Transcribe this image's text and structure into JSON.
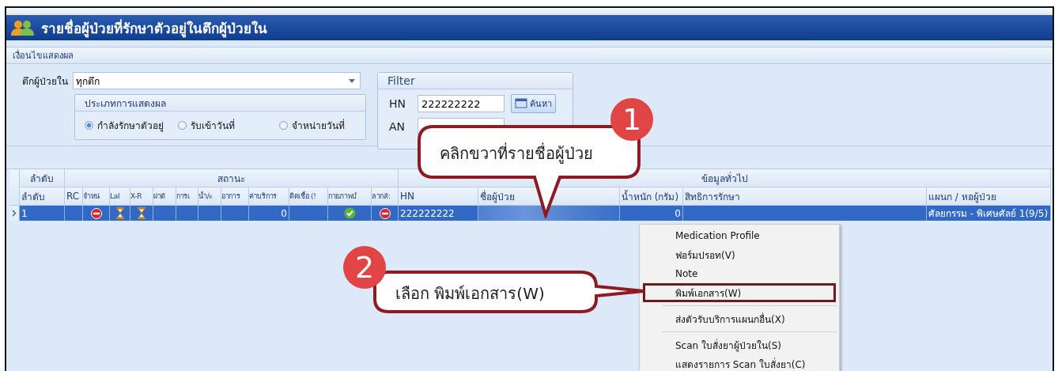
{
  "window": {
    "title": "รายชื่อผู้ป่วยที่รักษาตัวอยู่ในตึกผู้ป่วยใน"
  },
  "conditions_header": "เงื่อนไขแสดงผล",
  "ward": {
    "label": "ตึกผู้ป่วยใน",
    "value": "ทุกตึก"
  },
  "display_type": {
    "title": "ประเภทการแสดงผล",
    "options": [
      {
        "label": "กำลังรักษาตัวอยู่",
        "selected": true
      },
      {
        "label": "รับเข้าวันที่",
        "selected": false
      },
      {
        "label": "จำหน่ายวันที่",
        "selected": false
      }
    ]
  },
  "filter": {
    "title": "Filter",
    "hn_label": "HN",
    "hn_value": "222222222",
    "search_button": "ค้นหา",
    "an_label": "AN"
  },
  "table": {
    "group_headers": [
      "ลำดับ",
      "สถานะ",
      "ข้อมูลทั่วไป"
    ],
    "columns": [
      "ลำดับ",
      "RC",
      "จำหน่",
      "Lal",
      "X-R",
      "ผ่าตั",
      "การเ",
      "น้ำ/ะ",
      "อาการ",
      "ค่าบริการ",
      "ติดเชื้อ (!",
      "กายภาพบํ",
      "ลากลั:",
      "HN",
      "ชื่อผู้ป่วย",
      "น้ำหนัก (กรัม)",
      "สิทธิการรักษา",
      "แผนก / หอผู้ป่วย"
    ],
    "rows": [
      {
        "selected": true,
        "cells": [
          {
            "kind": "text",
            "text": "1"
          },
          {
            "kind": "empty"
          },
          {
            "kind": "stop"
          },
          {
            "kind": "hourglass"
          },
          {
            "kind": "hourglass"
          },
          {
            "kind": "empty"
          },
          {
            "kind": "empty"
          },
          {
            "kind": "empty"
          },
          {
            "kind": "empty"
          },
          {
            "kind": "number",
            "text": "0"
          },
          {
            "kind": "empty"
          },
          {
            "kind": "check"
          },
          {
            "kind": "stop"
          },
          {
            "kind": "text",
            "text": "222222222"
          },
          {
            "kind": "hidden"
          },
          {
            "kind": "number",
            "text": "0"
          },
          {
            "kind": "empty"
          },
          {
            "kind": "text",
            "text": "ศัลยกรรม - พิเศษศัลย์ 1(9/5)"
          }
        ]
      }
    ]
  },
  "context_menu": [
    {
      "label": "Medication Profile",
      "separator_before": false,
      "outlined": false
    },
    {
      "label": "ฟอร์มปรอท(V)",
      "separator_before": false,
      "outlined": false
    },
    {
      "label": "Note",
      "separator_before": false,
      "outlined": false
    },
    {
      "label": "พิมพ์เอกสาร(W)",
      "separator_before": false,
      "outlined": true
    },
    {
      "label": "ส่งตัวรับบริการแผนกอื่น(X)",
      "separator_before": true,
      "outlined": false
    },
    {
      "label": "Scan ใบสั่งยาผู้ป่วยใน(S)",
      "separator_before": true,
      "outlined": false
    },
    {
      "label": "แสดงรายการ Scan ใบสั่งยา(C)",
      "separator_before": false,
      "outlined": false
    }
  ],
  "callouts": [
    {
      "number": "1",
      "text": "คลิกขวาที่รายชื่อผู้ป่วย"
    },
    {
      "number": "2",
      "text": "เลือก พิมพ์เอกสาร(W)"
    }
  ]
}
